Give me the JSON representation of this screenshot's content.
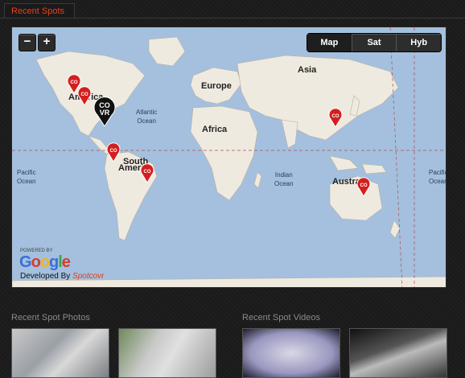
{
  "tab": {
    "label": "Recent Spots"
  },
  "map": {
    "zoom_in": "+",
    "zoom_out": "−",
    "types": [
      "Map",
      "Sat",
      "Hyb"
    ],
    "active_type": "Map",
    "labels": {
      "europe": "Europe",
      "asia": "Asia",
      "africa": "Africa",
      "america": "America",
      "south": "South",
      "america2": "America",
      "australia": "Australia",
      "atlantic": "Atlantic\nOcean",
      "indian": "Indian\nOcean",
      "pacific_left": "Pacific\nOcean",
      "pacific_right": "Pacific\nOcean"
    },
    "powered_by": "POWERED BY",
    "google": "Google",
    "developed_by": "Developed By",
    "developer": "Spotcovr",
    "pin_text": "CO\nVR"
  },
  "photos": {
    "title": "Recent Spot Photos"
  },
  "videos": {
    "title": "Recent Spot Videos"
  }
}
